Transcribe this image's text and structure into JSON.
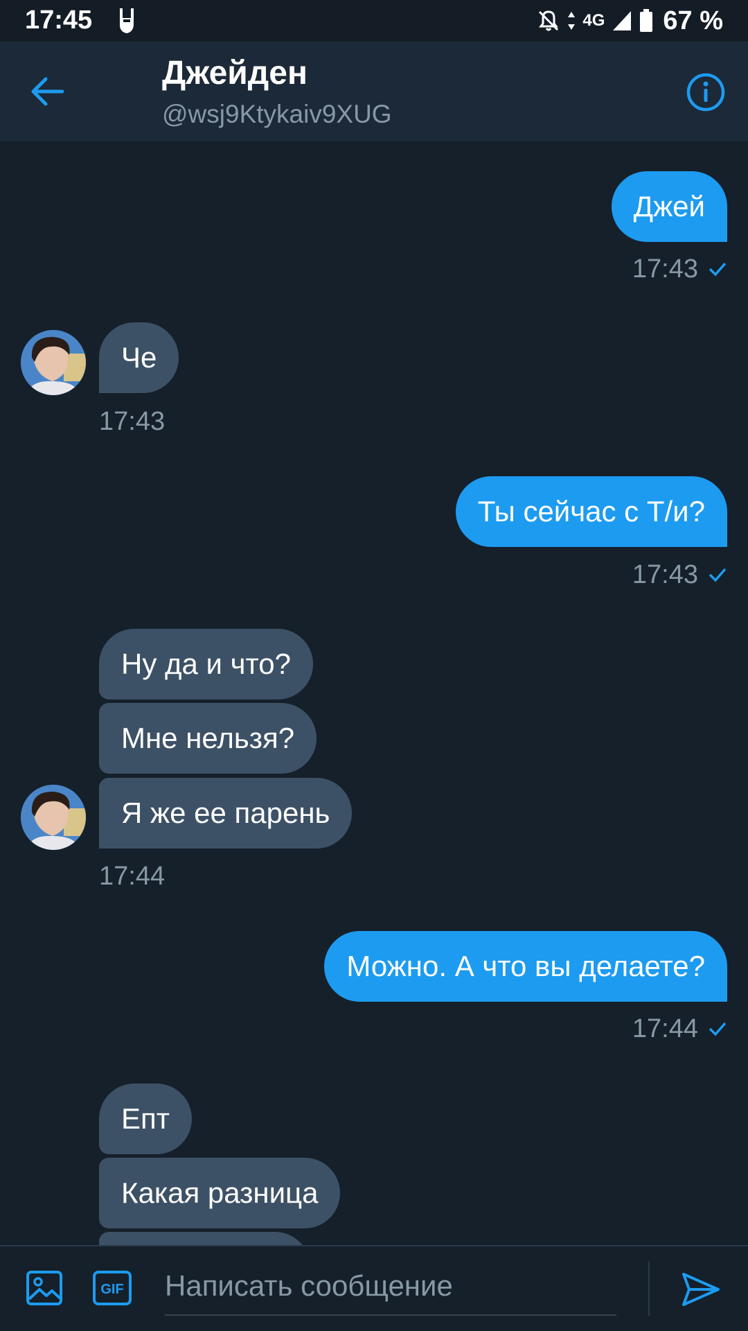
{
  "status_bar": {
    "time": "17:45",
    "network": "4G",
    "battery": "67 %"
  },
  "header": {
    "name": "Джейден",
    "handle": "@wsj9Ktykaiv9XUG"
  },
  "colors": {
    "background": "#15202b",
    "header": "#1c2938",
    "outgoing_bubble": "#1d9bf0",
    "incoming_bubble": "#3d5166",
    "muted_text": "#8899a6"
  },
  "messages": {
    "m1": {
      "text": "Джей",
      "time": "17:43"
    },
    "m2": {
      "text": "Че",
      "time": "17:43"
    },
    "m3": {
      "text": "Ты сейчас с Т/и?",
      "time": "17:43"
    },
    "m4": {
      "text": "Ну да и что?"
    },
    "m5": {
      "text": "Мне нельзя?"
    },
    "m6": {
      "text": "Я же ее парень",
      "time": "17:44"
    },
    "m7": {
      "text": "Можно. А что вы делаете?",
      "time": "17:44"
    },
    "m8": {
      "text": "Епт"
    },
    "m9": {
      "text": "Какая разница"
    }
  },
  "composer": {
    "placeholder": "Написать сообщение",
    "gif_label": "GIF"
  }
}
